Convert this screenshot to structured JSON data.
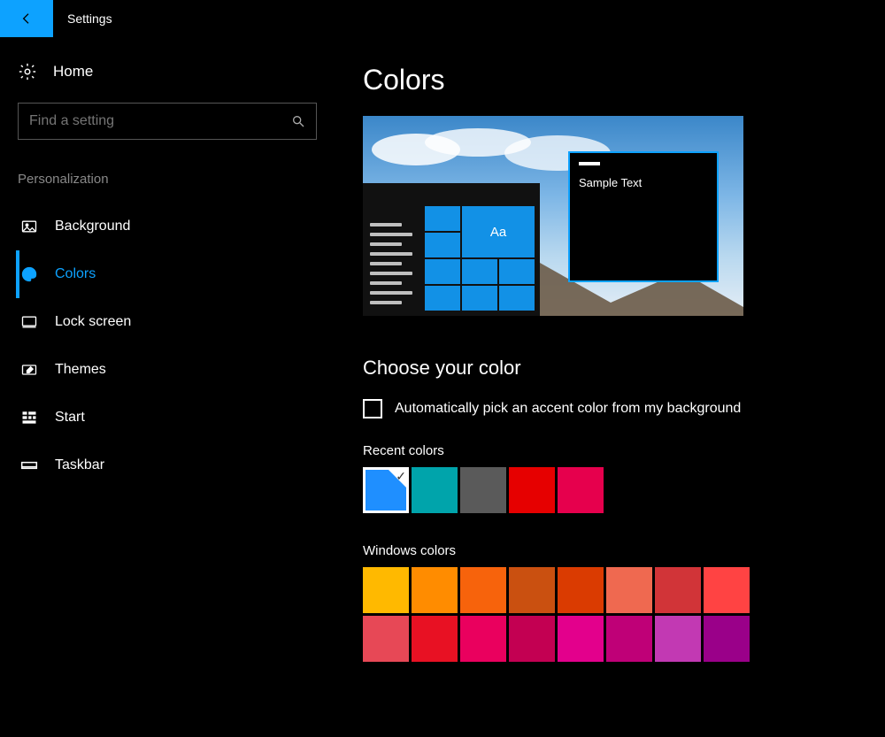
{
  "titlebar": {
    "title": "Settings"
  },
  "sidebar": {
    "home_label": "Home",
    "search_placeholder": "Find a setting",
    "section_label": "Personalization",
    "items": [
      {
        "label": "Background"
      },
      {
        "label": "Colors"
      },
      {
        "label": "Lock screen"
      },
      {
        "label": "Themes"
      },
      {
        "label": "Start"
      },
      {
        "label": "Taskbar"
      }
    ]
  },
  "main": {
    "page_title": "Colors",
    "preview": {
      "sample_text": "Sample Text",
      "tile_label": "Aa"
    },
    "choose_heading": "Choose your color",
    "auto_pick_label": "Automatically pick an accent color from my background",
    "recent_label": "Recent colors",
    "recent_colors": [
      "#1f8fff",
      "#00a4ab",
      "#5a5a5a",
      "#e60000",
      "#e6004d"
    ],
    "recent_selected_index": 0,
    "windows_label": "Windows colors",
    "windows_colors": [
      "#ffb900",
      "#ff8c00",
      "#f7630c",
      "#ca5010",
      "#da3b01",
      "#ef6950",
      "#d13438",
      "#ff4343",
      "#e74856",
      "#e81123",
      "#ea005e",
      "#c30052",
      "#e3008c",
      "#bf0077",
      "#c239b3",
      "#9a0089"
    ]
  }
}
